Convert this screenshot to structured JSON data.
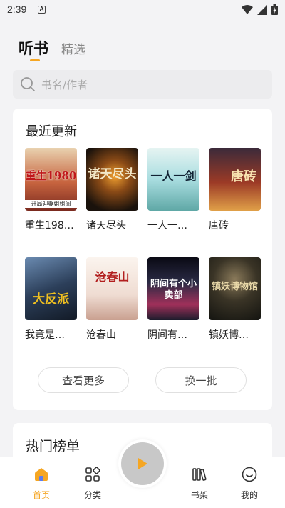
{
  "status": {
    "time": "2:39",
    "notif_letter": "A"
  },
  "tabs": {
    "active": "听书",
    "inactive": "精选"
  },
  "search": {
    "placeholder": "书名/作者"
  },
  "recent": {
    "title": "最近更新",
    "books": [
      {
        "title": "重生198…",
        "cover_text": "重生1980",
        "cover_sub": "开局迎娶姐姐闺",
        "color": "#b8493a"
      },
      {
        "title": "诸天尽头",
        "cover_text": "诸天尽头",
        "color": "#3a2a1a"
      },
      {
        "title": "一人一…",
        "cover_text": "一人一剑",
        "color": "#bfe3e6"
      },
      {
        "title": "唐砖",
        "cover_text": "唐砖",
        "color": "#5a2a22"
      },
      {
        "title": "我竟是…",
        "cover_text": "大反派",
        "color": "#2c3f5a"
      },
      {
        "title": "沧春山",
        "cover_text": "沧春山",
        "color": "#f2e8e0"
      },
      {
        "title": "阴间有…",
        "cover_text": "阴间有个小卖部",
        "color": "#1c1c2c"
      },
      {
        "title": "镇妖博…",
        "cover_text": "镇妖博物馆",
        "color": "#2a2a22"
      }
    ],
    "more_button": "查看更多",
    "refresh_button": "换一批"
  },
  "hot": {
    "title": "热门榜单"
  },
  "nav": {
    "home": "首页",
    "category": "分类",
    "shelf": "书架",
    "mine": "我的"
  },
  "colors": {
    "accent": "#f5a623",
    "background": "#f3f3f5"
  }
}
